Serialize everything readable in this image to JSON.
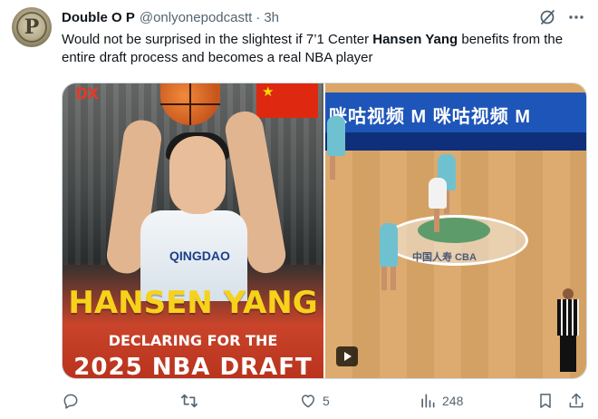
{
  "tweet": {
    "author_name": "Double O P",
    "author_handle": "@onlyonepodcastt",
    "separator": "·",
    "time_ago": "3h",
    "avatar_letter": "P",
    "text_before": "Would not be surprised in the slightest if 7’1 Center ",
    "text_bold": "Hansen Yang",
    "text_after": " benefits from the entire draft process and becomes a real NBA player"
  },
  "header_icons": [
    "grok-icon",
    "more-icon"
  ],
  "media": {
    "left_image": {
      "logo_text": "DX",
      "jersey_text": "QINGDAO",
      "headline": "HANSEN YANG",
      "subline": "DECLARING FOR THE",
      "bottom_line": "2025 NBA DRAFT"
    },
    "right_image": {
      "ad_board_text": "咪咕视频 M 咪咕视频 M",
      "court_logo_text": "中国人寿 CBA"
    }
  },
  "actions": {
    "reply_count": "",
    "retweet_count": "",
    "like_count": "5",
    "views_count": "248"
  },
  "colors": {
    "text_primary": "#0f1419",
    "text_secondary": "#536471",
    "headline_yellow": "#f7d21b",
    "banner_red": "#c9442a",
    "court_wood": "#dba667"
  }
}
